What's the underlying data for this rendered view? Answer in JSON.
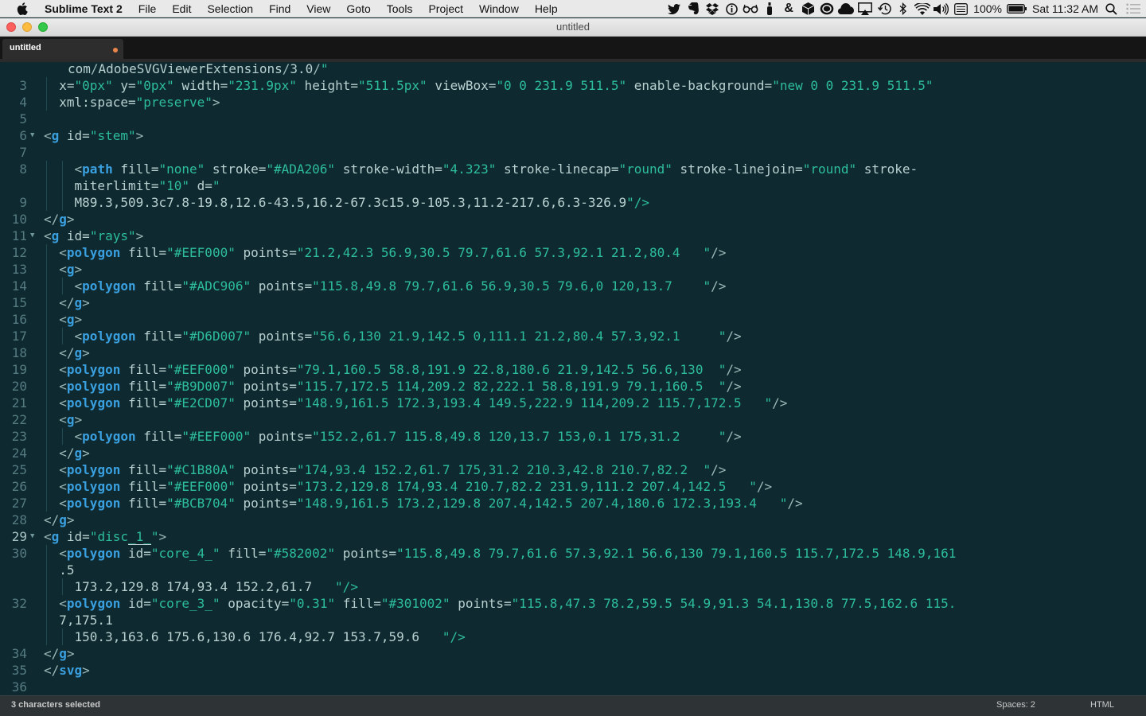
{
  "menubar": {
    "app_name": "Sublime Text 2",
    "items": [
      "File",
      "Edit",
      "Selection",
      "Find",
      "View",
      "Goto",
      "Tools",
      "Project",
      "Window",
      "Help"
    ],
    "status": {
      "battery": "100%",
      "clock": "Sat 11:32 AM",
      "icons": [
        "twitter-icon",
        "evernote-icon",
        "dropbox-icon",
        "info-icon",
        "glasses-icon",
        "bottle-icon",
        "ampersand-icon",
        "box-icon",
        "record-icon",
        "cloud-icon",
        "airplay-icon",
        "time-machine-icon",
        "bluetooth-icon",
        "wifi-icon",
        "volume-icon",
        "keyboard-icon",
        "battery-icon",
        "spotlight-icon",
        "notification-center-icon"
      ]
    }
  },
  "window": {
    "title": "untitled"
  },
  "tab": {
    "label": "untitled",
    "modified_color": "#e9864a"
  },
  "editor": {
    "partial_top_line": "com/AdobeSVGViewerExtensions/3.0/\"",
    "cursor_line": 29,
    "lines": [
      {
        "n": 3,
        "wraps": [
          "  x=\"0px\" y=\"0px\" width=\"231.9px\" height=\"511.5px\" viewBox=\"0 0 231.9 511.5\" enable-background=\"new 0 0 231.9 511.5\""
        ]
      },
      {
        "n": 4,
        "wraps": [
          "  xml:space=\"preserve\">"
        ]
      },
      {
        "n": 5,
        "wraps": [
          ""
        ]
      },
      {
        "n": 6,
        "fold": true,
        "wraps": [
          "<g id=\"stem\">"
        ]
      },
      {
        "n": 7,
        "wraps": [
          ""
        ]
      },
      {
        "n": 8,
        "wraps": [
          "    <path fill=\"none\" stroke=\"#ADA206\" stroke-width=\"4.323\" stroke-linecap=\"round\" stroke-linejoin=\"round\" stroke-",
          "    miterlimit=\"10\" d=\""
        ]
      },
      {
        "n": 9,
        "wraps": [
          "    M89.3,509.3c7.8-19.8,12.6-43.5,16.2-67.3c15.9-105.3,11.2-217.6,6.3-326.9\"/>"
        ]
      },
      {
        "n": 10,
        "wraps": [
          "</g>"
        ]
      },
      {
        "n": 11,
        "fold": true,
        "wraps": [
          "<g id=\"rays\">"
        ]
      },
      {
        "n": 12,
        "wraps": [
          "  <polygon fill=\"#EEF000\" points=\"21.2,42.3 56.9,30.5 79.7,61.6 57.3,92.1 21.2,80.4   \"/>"
        ]
      },
      {
        "n": 13,
        "wraps": [
          "  <g>"
        ]
      },
      {
        "n": 14,
        "wraps": [
          "    <polygon fill=\"#ADC906\" points=\"115.8,49.8 79.7,61.6 56.9,30.5 79.6,0 120,13.7    \"/>"
        ]
      },
      {
        "n": 15,
        "wraps": [
          "  </g>"
        ]
      },
      {
        "n": 16,
        "wraps": [
          "  <g>"
        ]
      },
      {
        "n": 17,
        "wraps": [
          "    <polygon fill=\"#D6D007\" points=\"56.6,130 21.9,142.5 0,111.1 21.2,80.4 57.3,92.1     \"/>"
        ]
      },
      {
        "n": 18,
        "wraps": [
          "  </g>"
        ]
      },
      {
        "n": 19,
        "wraps": [
          "  <polygon fill=\"#EEF000\" points=\"79.1,160.5 58.8,191.9 22.8,180.6 21.9,142.5 56.6,130  \"/>"
        ]
      },
      {
        "n": 20,
        "wraps": [
          "  <polygon fill=\"#B9D007\" points=\"115.7,172.5 114,209.2 82,222.1 58.8,191.9 79.1,160.5  \"/>"
        ]
      },
      {
        "n": 21,
        "wraps": [
          "  <polygon fill=\"#E2CD07\" points=\"148.9,161.5 172.3,193.4 149.5,222.9 114,209.2 115.7,172.5   \"/>"
        ]
      },
      {
        "n": 22,
        "wraps": [
          "  <g>"
        ]
      },
      {
        "n": 23,
        "wraps": [
          "    <polygon fill=\"#EEF000\" points=\"152.2,61.7 115.8,49.8 120,13.7 153,0.1 175,31.2     \"/>"
        ]
      },
      {
        "n": 24,
        "wraps": [
          "  </g>"
        ]
      },
      {
        "n": 25,
        "wraps": [
          "  <polygon fill=\"#C1B80A\" points=\"174,93.4 152.2,61.7 175,31.2 210.3,42.8 210.7,82.2  \"/>"
        ]
      },
      {
        "n": 26,
        "wraps": [
          "  <polygon fill=\"#EEF000\" points=\"173.2,129.8 174,93.4 210.7,82.2 231.9,111.2 207.4,142.5   \"/>"
        ]
      },
      {
        "n": 27,
        "wraps": [
          "  <polygon fill=\"#BCB704\" points=\"148.9,161.5 173.2,129.8 207.4,142.5 207.4,180.6 172.3,193.4   \"/>"
        ]
      },
      {
        "n": 28,
        "wraps": [
          "</g>"
        ]
      },
      {
        "n": 29,
        "fold": true,
        "wraps": [
          "<g id=\"disc_1_\">"
        ]
      },
      {
        "n": 30,
        "wraps": [
          "  <polygon id=\"core_4_\" fill=\"#582002\" points=\"115.8,49.8 79.7,61.6 57.3,92.1 56.6,130 79.1,160.5 115.7,172.5 148.9,161",
          "  .5",
          "    173.2,129.8 174,93.4 152.2,61.7   \"/>"
        ]
      },
      {
        "n": 32,
        "wraps": [
          "  <polygon id=\"core_3_\" opacity=\"0.31\" fill=\"#301002\" points=\"115.8,47.3 78.2,59.5 54.9,91.3 54.1,130.8 77.5,162.6 115.",
          "  7,175.1",
          "    150.3,163.6 175.6,130.6 176.4,92.7 153.7,59.6   \"/>"
        ]
      },
      {
        "n": 34,
        "wraps": [
          "</g>"
        ]
      },
      {
        "n": 35,
        "wraps": [
          "</svg>"
        ]
      },
      {
        "n": 36,
        "wraps": [
          ""
        ]
      }
    ]
  },
  "statusbar": {
    "selection": "3 characters selected",
    "indentation": "Spaces: 2",
    "syntax": "HTML"
  }
}
